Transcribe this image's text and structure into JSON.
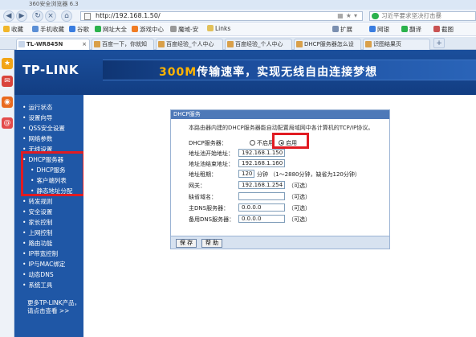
{
  "browser": {
    "title": "360安全浏览器 6.3",
    "url": "http://192.168.1.50/",
    "search_placeholder": "习近平要求坚决打击暴",
    "favorites": [
      "收藏",
      "手机收藏",
      "谷歌",
      "网址大全",
      "游戏中心",
      "魔域-安",
      "Links"
    ],
    "menu": [
      "扩展",
      "网银",
      "翻译",
      "截图"
    ],
    "tabs": [
      "TL-WR845N",
      "百度一下，你就知",
      "百度经验_个人中心",
      "百度经验_个人中心",
      "DHCP服务器怎么设",
      "识图结果页"
    ]
  },
  "header": {
    "logo": "TP-LINK",
    "banner_accent": "300M",
    "banner_text": "传输速率，实现无线自由连接梦想"
  },
  "menu": [
    {
      "label": "运行状态",
      "sub": false
    },
    {
      "label": "设置向导",
      "sub": false
    },
    {
      "label": "QSS安全设置",
      "sub": false
    },
    {
      "label": "网络参数",
      "sub": false
    },
    {
      "label": "无线设置",
      "sub": false
    },
    {
      "label": "DHCP服务器",
      "sub": false
    },
    {
      "label": "DHCP服务",
      "sub": true
    },
    {
      "label": "客户端列表",
      "sub": true
    },
    {
      "label": "静态地址分配",
      "sub": true
    },
    {
      "label": "转发规则",
      "sub": false
    },
    {
      "label": "安全设置",
      "sub": false
    },
    {
      "label": "家长控制",
      "sub": false
    },
    {
      "label": "上网控制",
      "sub": false
    },
    {
      "label": "路由功能",
      "sub": false
    },
    {
      "label": "IP带宽控制",
      "sub": false
    },
    {
      "label": "IP与MAC绑定",
      "sub": false
    },
    {
      "label": "动态DNS",
      "sub": false
    },
    {
      "label": "系统工具",
      "sub": false
    }
  ],
  "menu_more": [
    "更多TP-LINK产品，",
    "请点击查看 >>"
  ],
  "dhcp": {
    "panel_title": "DHCP服务",
    "intro": "本路由器内建的DHCP服务器能自动配置局域网中各计算机的TCP/IP协议。",
    "server_label": "DHCP服务器：",
    "off_label": "不启用",
    "on_label": "启用",
    "start_label": "地址池开始地址：",
    "start_value": "192.168.1.150",
    "end_label": "地址池结束地址：",
    "end_value": "192.168.1.160",
    "lease_label": "地址租期：",
    "lease_value": "120",
    "lease_hint": "分钟 （1～2880分钟，缺省为120分钟）",
    "gateway_label": "网关：",
    "gateway_value": "192.168.1.254",
    "domain_label": "缺省域名：",
    "domain_value": "",
    "dns1_label": "主DNS服务器：",
    "dns1_value": "0.0.0.0",
    "dns2_label": "备用DNS服务器：",
    "dns2_value": "0.0.0.0",
    "optional": "（可选）",
    "save": "保 存",
    "help": "帮 助"
  },
  "colors": {
    "accent_red": "#e11b22",
    "nav_blue": "#1f57a6"
  }
}
